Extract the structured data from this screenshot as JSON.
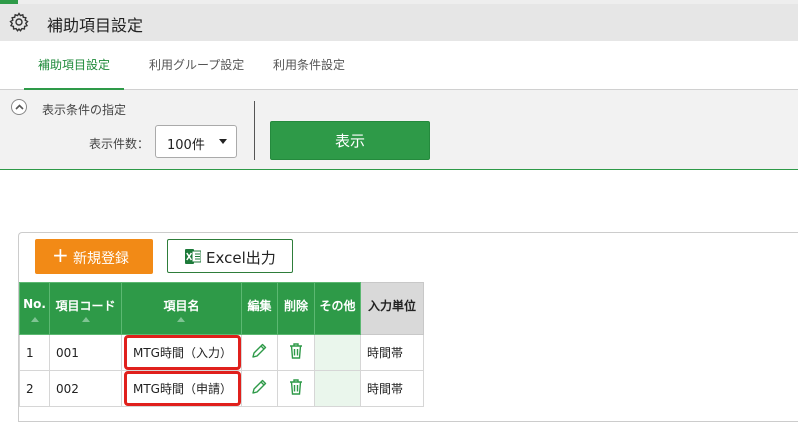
{
  "app": {
    "title": "補助項目設定",
    "icon": "gear-icon"
  },
  "tabs": [
    {
      "label": "補助項目設定",
      "active": true
    },
    {
      "label": "利用グループ設定",
      "active": false
    },
    {
      "label": "利用条件設定",
      "active": false
    }
  ],
  "conditions": {
    "toggle_label": "表示条件の指定",
    "count_label": "表示件数：",
    "count_value": "100件",
    "show_button": "表示"
  },
  "actions": {
    "new_button": "新規登録",
    "new_icon": "plus-icon",
    "excel_button": "Excel出力",
    "excel_icon": "excel-icon"
  },
  "table": {
    "headers": [
      "No.",
      "項目コード",
      "項目名",
      "編集",
      "削除",
      "その他",
      "入力単位"
    ],
    "rows": [
      {
        "no": "1",
        "code": "001",
        "name": "MTG時間（入力）",
        "unit": "時間帯"
      },
      {
        "no": "2",
        "code": "002",
        "name": "MTG時間（申請）",
        "unit": "時間帯"
      }
    ]
  },
  "colors": {
    "accent": "#2e9a48",
    "orange": "#f28a16",
    "highlight": "#e0201c"
  }
}
